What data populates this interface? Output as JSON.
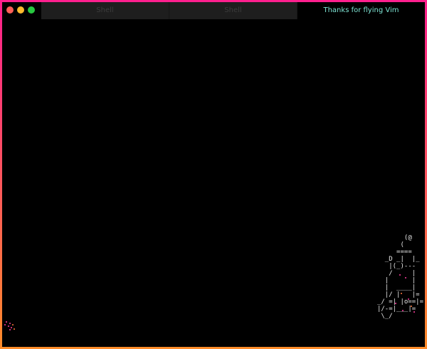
{
  "window": {
    "tabs": [
      {
        "label": "Shell",
        "active": false
      },
      {
        "label": "Shell",
        "active": false
      },
      {
        "label": "Thanks for flying Vim",
        "active": true
      }
    ],
    "traffic_lights": {
      "close": "#fe5f57",
      "minimize": "#febb2e",
      "maximize": "#28c840"
    }
  },
  "terminal": {
    "ascii_art": "        (@\n       (\n      ====\n   _D _|  |_\n    |(_)---\n    /     |\n   |      |\n   |  ____|\n   |/ |   |=\n _/ =| |o==|=\n |/-=|___|=\n  \\_/"
  },
  "accent_colors": {
    "border_top": "#ff1f8e",
    "border_bottom": "#ff8c2a",
    "active_tab_text": "#7fe6d6"
  }
}
